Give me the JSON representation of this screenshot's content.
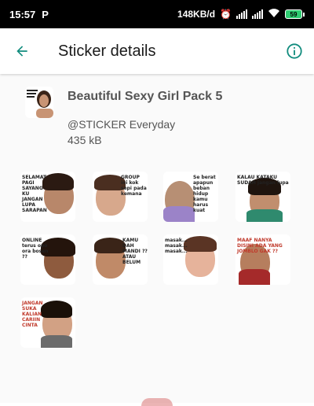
{
  "status_bar": {
    "time": "15:57",
    "left_icon_letter": "P",
    "net_speed": "148KB/d",
    "battery": "59"
  },
  "app_bar": {
    "title": "Sticker details",
    "back_icon": "arrow-left-icon",
    "info_icon": "info-icon",
    "accent_color": "#128C7E"
  },
  "pack": {
    "name": "Beautiful Sexy Girl Pack 5",
    "publisher": "@STICKER Everyday",
    "size": "435 kB"
  },
  "stickers": [
    {
      "name": "sticker-1",
      "caption": "SELAMAT PAGI SAYANG KU JANGAN LUPA SARAPAN"
    },
    {
      "name": "sticker-2",
      "caption": "GROUP ini kok sepi pada kemana"
    },
    {
      "name": "sticker-3",
      "caption": "Se berat apapun beban hidup kamu harus kuat"
    },
    {
      "name": "sticker-4",
      "caption": "KALAU KATAKU SUDAH jangan lupa"
    },
    {
      "name": "sticker-5",
      "caption": "ONLINE terus opo ora bosen ??"
    },
    {
      "name": "sticker-6",
      "caption": "KAMU DAH MANDI ?? ATAU BELUM"
    },
    {
      "name": "sticker-7",
      "caption": "masak... masak... masak..."
    },
    {
      "name": "sticker-8",
      "caption": "MAAF NANYA DISINI ADA YANG JOMBLO GAK ??"
    },
    {
      "name": "sticker-9",
      "caption": "JANGAN SUKA KALIAN CARIIN CINTA"
    }
  ]
}
